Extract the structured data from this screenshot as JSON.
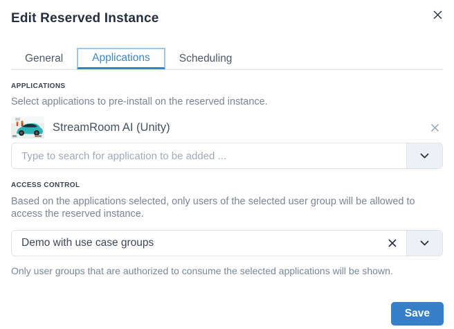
{
  "modal": {
    "title": "Edit Reserved Instance"
  },
  "tabs": [
    {
      "label": "General",
      "active": false
    },
    {
      "label": "Applications",
      "active": true
    },
    {
      "label": "Scheduling",
      "active": false
    }
  ],
  "applications": {
    "label": "APPLICATIONS",
    "description": "Select applications to pre-install on the reserved instance.",
    "selected_apps": [
      {
        "name": "StreamRoom AI (Unity)"
      }
    ],
    "search_placeholder": "Type to search for application to be added ..."
  },
  "access_control": {
    "label": "ACCESS CONTROL",
    "description": "Based on the applications selected, only users of the selected user group will be allowed to access the reserved instance.",
    "selected_group": "Demo with use case groups",
    "helper": "Only user groups that are authorized to consume the selected applications will be shown."
  },
  "footer": {
    "save_label": "Save"
  },
  "icons": {
    "close": "close-icon",
    "remove": "remove-icon",
    "clear": "clear-icon",
    "chevron_down": "chevron-down-icon"
  },
  "colors": {
    "accent_blue": "#3e86c8",
    "active_tab_underline": "#3a80c4",
    "focus_ring": "#a2c6e8",
    "save_button": "#3780c9",
    "title_text": "#252f3e",
    "muted_text": "#7b8695",
    "input_border": "#dfe3e8",
    "dropdown_button_bg": "#edf1f5"
  }
}
